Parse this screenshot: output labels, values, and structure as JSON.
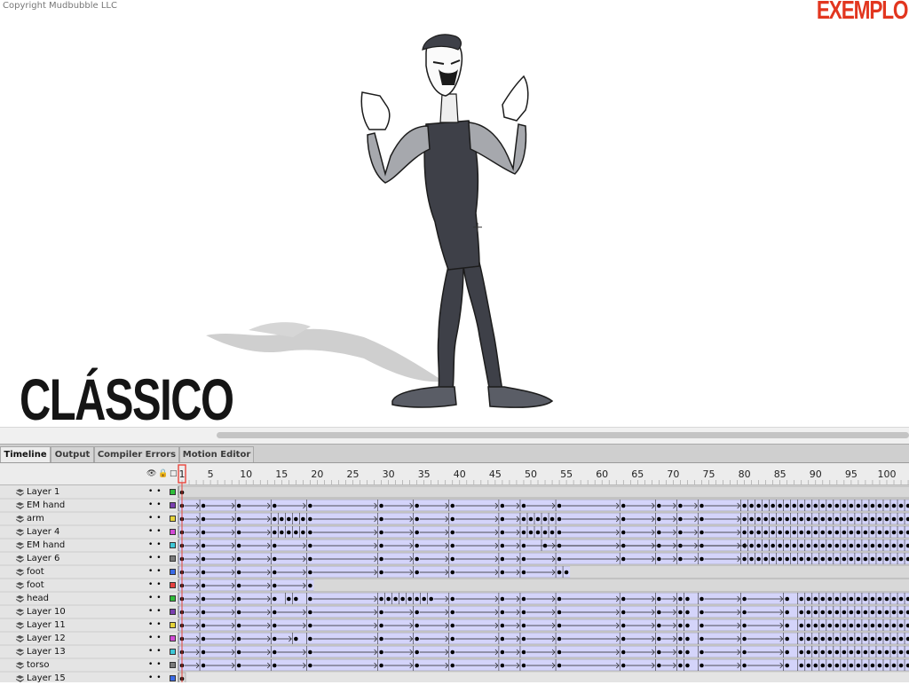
{
  "copyright": "Copyright Mudbubble LLC",
  "label_exemplo": "EXEMPLO",
  "label_classico": "CLÁSSICO",
  "tabs": [
    {
      "label": "Timeline",
      "active": true
    },
    {
      "label": "Output",
      "active": false
    },
    {
      "label": "Compiler Errors",
      "active": false
    },
    {
      "label": "Motion Editor",
      "active": false
    }
  ],
  "header_icons": [
    "eye-icon",
    "lock-icon",
    "outline-icon"
  ],
  "frame_numbers": [
    "1",
    "5",
    "10",
    "15",
    "20",
    "25",
    "30",
    "35",
    "40",
    "45",
    "50",
    "55",
    "60",
    "65",
    "70",
    "75",
    "80",
    "85",
    "90",
    "95",
    "100"
  ],
  "current_frame": 1,
  "layers": [
    {
      "name": "Layer 1",
      "color": "#2fbd3a"
    },
    {
      "name": "EM hand",
      "color": "#7a3fb0"
    },
    {
      "name": "arm",
      "color": "#e6d33a"
    },
    {
      "name": "Layer 4",
      "color": "#d24ad6"
    },
    {
      "name": "EM hand",
      "color": "#3ec8d8"
    },
    {
      "name": "Layer 6",
      "color": "#7a7a7a"
    },
    {
      "name": "foot",
      "color": "#3a6ae6"
    },
    {
      "name": "foot",
      "color": "#e64040"
    },
    {
      "name": "head",
      "color": "#2fbd3a"
    },
    {
      "name": "Layer 10",
      "color": "#7a3fb0"
    },
    {
      "name": "Layer 11",
      "color": "#e6d33a"
    },
    {
      "name": "Layer 12",
      "color": "#d24ad6"
    },
    {
      "name": "Layer 13",
      "color": "#3ec8d8"
    },
    {
      "name": "torso",
      "color": "#7a7a7a"
    },
    {
      "name": "Layer 15",
      "color": "#3a6ae6"
    }
  ],
  "colors": {
    "tween": "#d4d4fa",
    "static": "#d8d8d8",
    "playhead": "#e8453c",
    "accent_red": "#e2361f"
  }
}
